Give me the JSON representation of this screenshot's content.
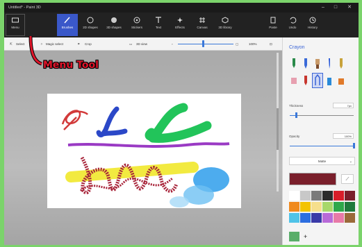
{
  "window": {
    "title": "Untitled* - Paint 3D",
    "minimize": "–",
    "maximize": "□",
    "close": "✕"
  },
  "ribbon": [
    {
      "label": "Menu",
      "icon": "folder-icon"
    },
    {
      "label": "Brushes",
      "icon": "brush-icon"
    },
    {
      "label": "2D shapes",
      "icon": "2d-shapes-icon"
    },
    {
      "label": "3D shapes",
      "icon": "3d-shapes-icon"
    },
    {
      "label": "Stickers",
      "icon": "stickers-icon"
    },
    {
      "label": "Text",
      "icon": "text-icon"
    },
    {
      "label": "Effects",
      "icon": "effects-icon"
    },
    {
      "label": "Canvas",
      "icon": "canvas-icon"
    },
    {
      "label": "3D library",
      "icon": "3d-library-icon"
    },
    {
      "label": "Paste",
      "icon": "paste-icon"
    },
    {
      "label": "Undo",
      "icon": "undo-icon"
    },
    {
      "label": "History",
      "icon": "history-icon"
    }
  ],
  "toolbar": {
    "select": "Select",
    "magic_select": "Magic select",
    "crop": "Crop",
    "view_3d": "3D view",
    "zoom": "100%"
  },
  "annotation": "Menu Tool",
  "panel": {
    "title": "Crayon",
    "thickness_label": "Thickness",
    "thickness_value": "7px",
    "thickness_level": 0.1,
    "opacity_label": "Opacity",
    "opacity_value": "100%",
    "opacity_level": 1.0,
    "finish": "Matte",
    "current_color": "#7a1f2b",
    "palette": [
      "#ffffff",
      "#c8c8c8",
      "#7a7a7a",
      "#2b2b2b",
      "#d81e2a",
      "#7a1f2b",
      "#f08a1e",
      "#f3c300",
      "#f6df8c",
      "#a8d86a",
      "#2ea84a",
      "#1e7a3c",
      "#4fc3e8",
      "#2d6ee0",
      "#3a3aa8",
      "#b86ad8",
      "#e87aa8",
      "#9a6a3a"
    ]
  },
  "accent": "#3a58c9"
}
